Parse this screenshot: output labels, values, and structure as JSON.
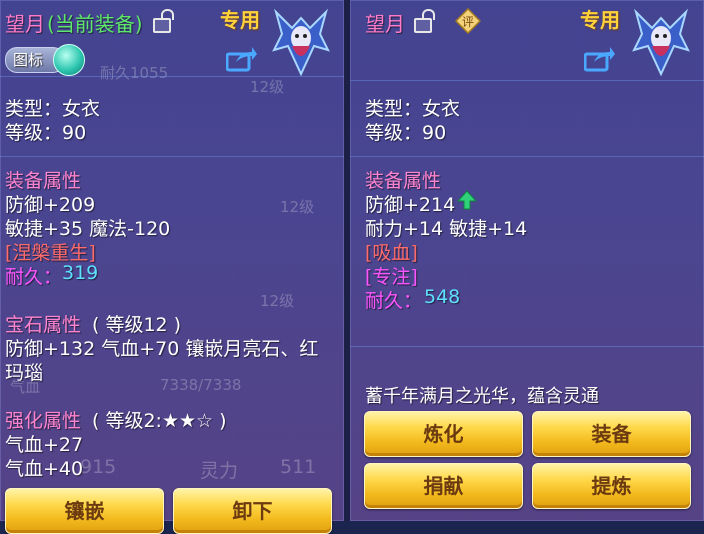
{
  "colors": {
    "title_pink": "#ff7ac8",
    "gold": "#ffd23a",
    "red": "#ff6b6b",
    "magenta": "#ff55ff",
    "cyan": "#5ee0ff",
    "button": "#ffd94a",
    "up_arrow": "#2fd27a"
  },
  "left": {
    "title_name": "望月",
    "title_current": "(当前装备)",
    "exclusive": "专用",
    "badge_label": "图标",
    "type": "类型：女衣",
    "level": "等级：90",
    "equip_attr_title": "装备属性",
    "attr1": "防御+209",
    "attr2": "敏捷+35 魔法-120",
    "special": "[涅槃重生]",
    "durability_label": "耐久：",
    "durability_value": "319",
    "gem_title": "宝石属性",
    "gem_level": "( 等级12 )",
    "gem_line1": "防御+132 气血+70 镶嵌月亮石、红",
    "gem_line2": "玛瑙",
    "strengthen_title": "强化属性",
    "strengthen_level": "( 等级2:★★☆ )",
    "strengthen1": "气血+27",
    "strengthen2": "气血+40",
    "buttons": [
      "镶嵌",
      "卸下"
    ]
  },
  "right": {
    "title_name": "望月",
    "ping_label": "评",
    "exclusive": "专用",
    "type": "类型：女衣",
    "level": "等级：90",
    "equip_attr_title": "装备属性",
    "attr1": "防御+214",
    "attr2": "耐力+14 敏捷+14",
    "special1": "[吸血]",
    "special2": "[专注]",
    "durability_label": "耐久：",
    "durability_value": "548",
    "description": "蓄千年满月之光华，蕴含灵通",
    "buttons": [
      "炼化",
      "装备",
      "捐献",
      "提炼"
    ]
  },
  "background": {
    "ghost_texts": [
      "耐久1055",
      "12级",
      "12级",
      "7338/7338",
      "气血",
      "灵力",
      "511",
      "915",
      "12级"
    ]
  }
}
